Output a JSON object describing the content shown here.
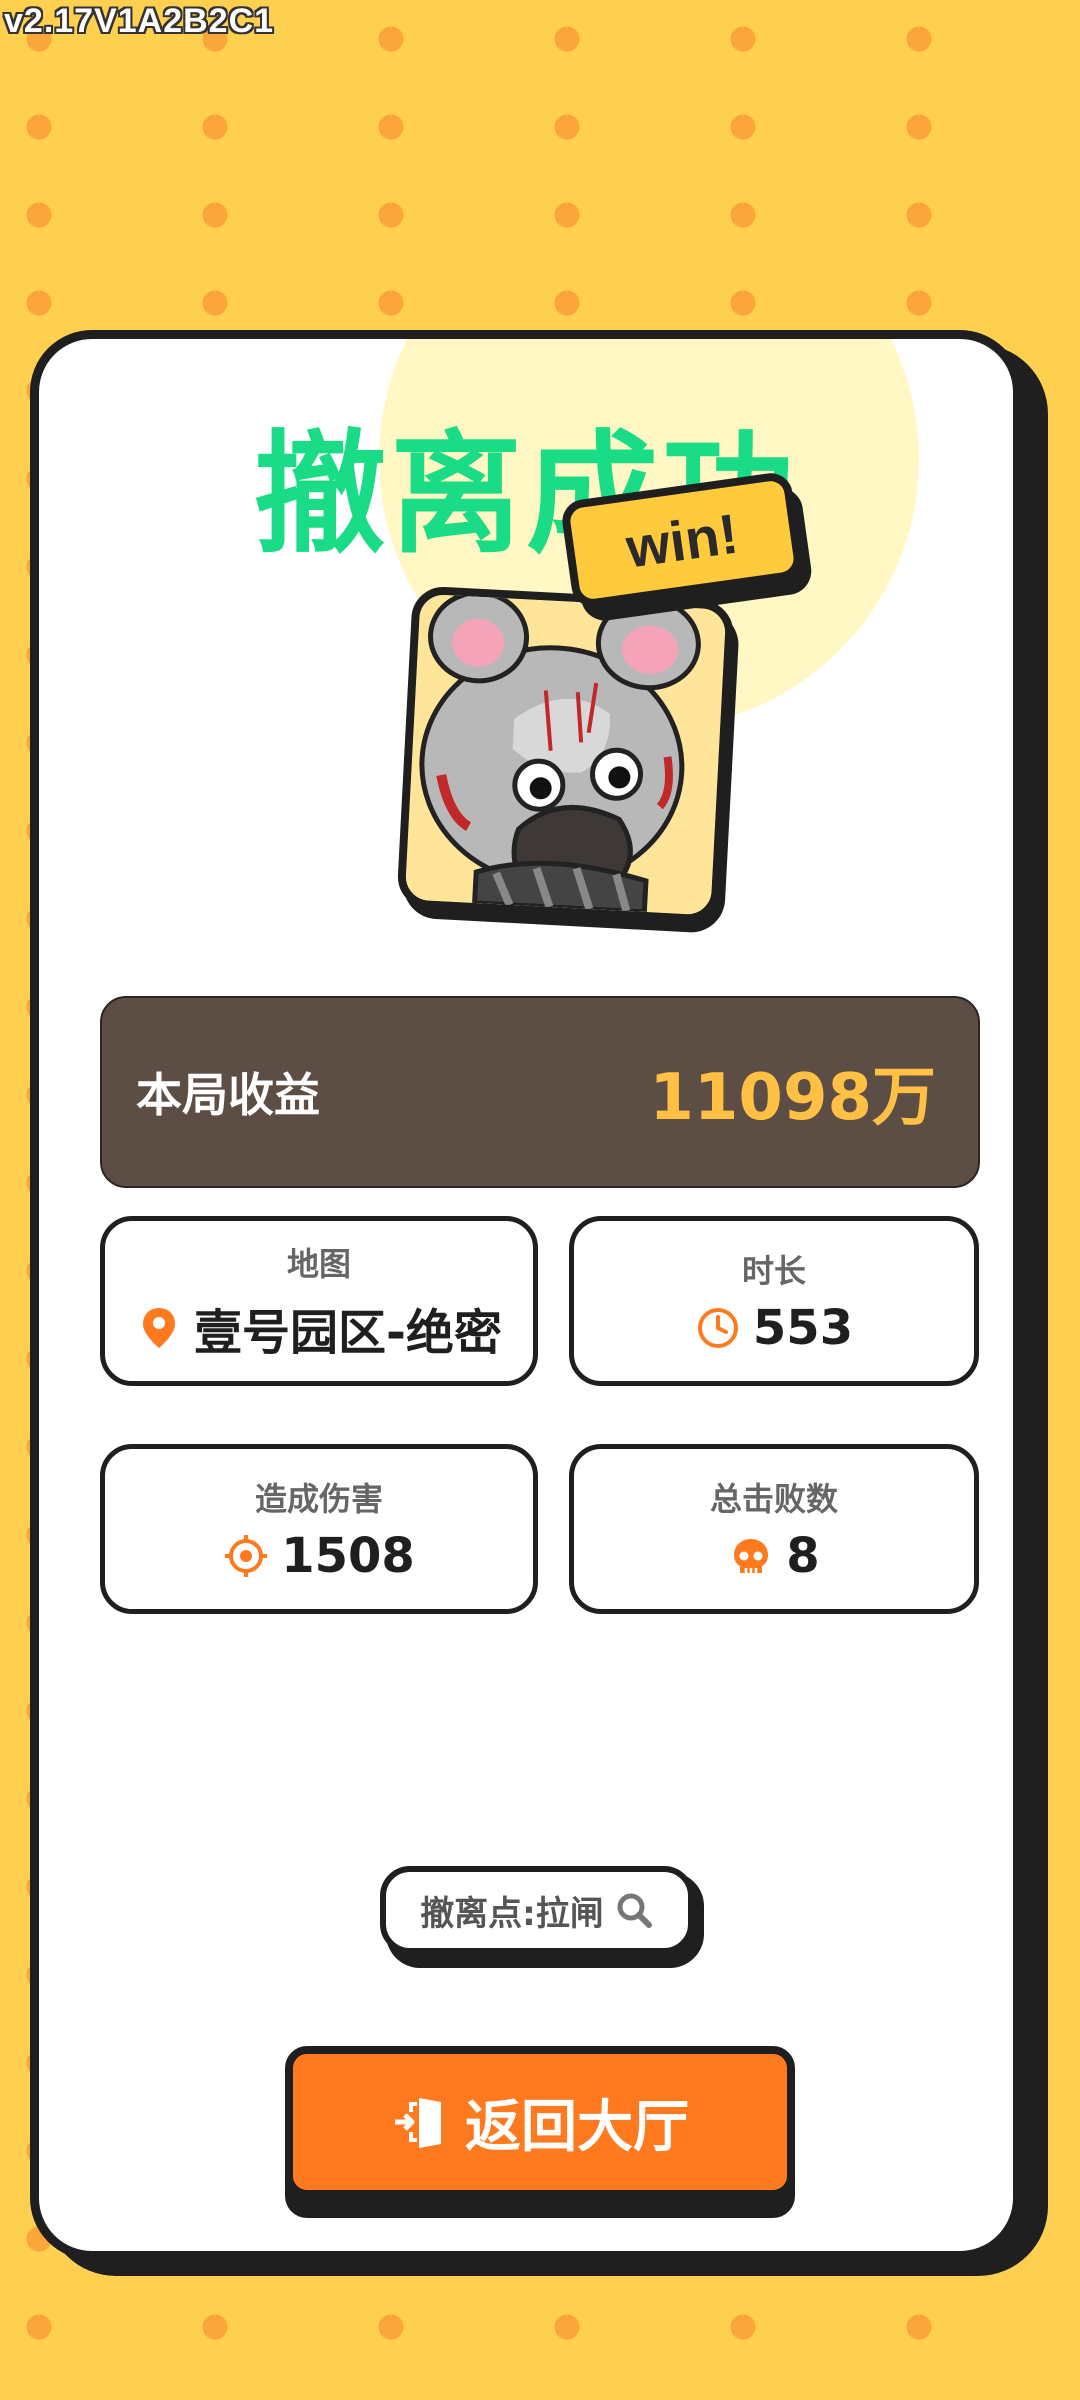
{
  "version": "v2.17V1A2B2C1",
  "result": {
    "title": "撤离成功",
    "badge": "win!"
  },
  "earnings": {
    "label": "本局收益",
    "value": "11098万"
  },
  "stats": [
    {
      "label": "地图",
      "value": "壹号园区-绝密",
      "icon": "location-pin-icon"
    },
    {
      "label": "时长",
      "value": "553",
      "icon": "clock-icon"
    },
    {
      "label": "造成伤害",
      "value": "1508",
      "icon": "crosshair-icon"
    },
    {
      "label": "总击败数",
      "value": "8",
      "icon": "skull-icon"
    }
  ],
  "exit_point": {
    "label": "撤离点:拉闸",
    "icon": "search-icon"
  },
  "return_button": {
    "label": "返回大厅",
    "icon": "exit-door-icon"
  },
  "colors": {
    "background": "#FFD04F",
    "dots": "#FAA63A",
    "title": "#1ADB86",
    "earnings_panel": "#5C4E45",
    "earnings_value": "#FFC044",
    "accent": "#FF7A1F"
  }
}
